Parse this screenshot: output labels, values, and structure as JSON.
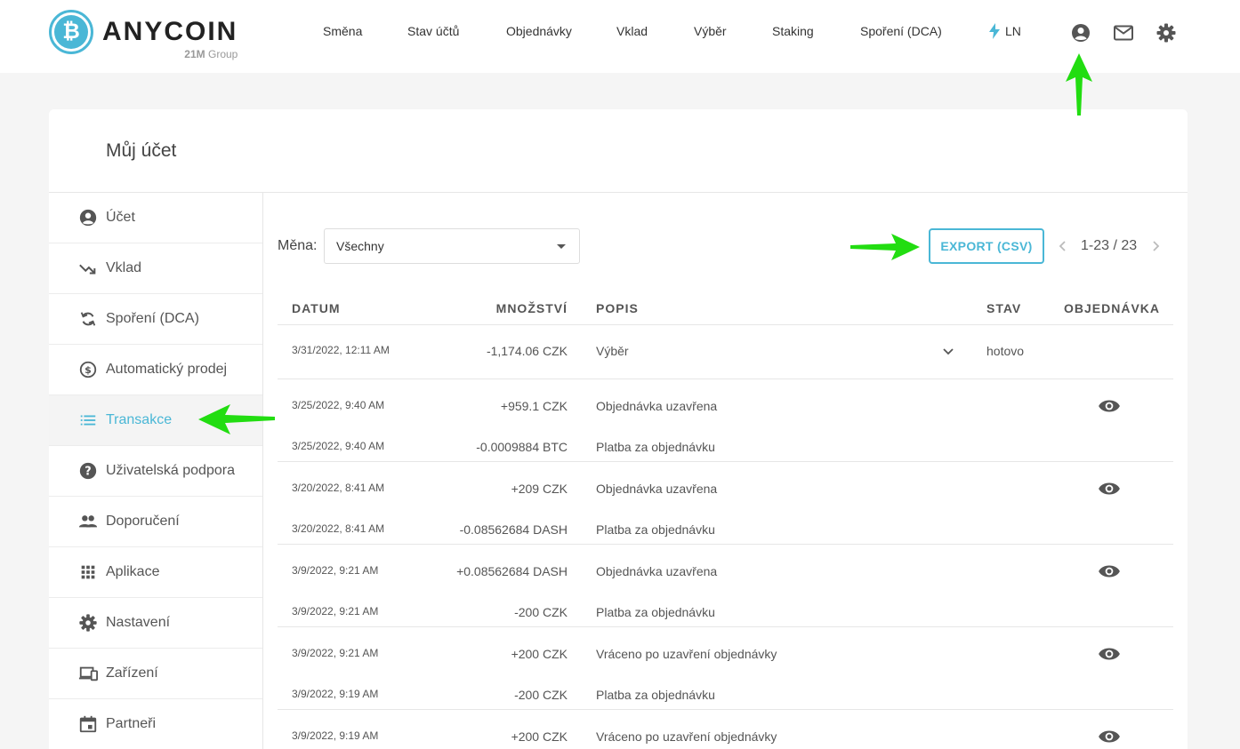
{
  "brand": {
    "name": "ANYCOIN",
    "sub_bold": "21M",
    "sub": "Group",
    "logo_glyph": "₿",
    "accent": "#4ab7d6"
  },
  "nav": {
    "items": [
      "Směna",
      "Stav účtů",
      "Objednávky",
      "Vklad",
      "Výběr",
      "Staking",
      "Spoření (DCA)"
    ],
    "ln_label": "LN"
  },
  "icons": {
    "account": "account-circle-icon",
    "mail": "mail-icon",
    "settings": "gear-icon"
  },
  "page": {
    "title": "Můj účet"
  },
  "sidebar": {
    "items": [
      {
        "label": "Účet",
        "icon": "account-circle-icon"
      },
      {
        "label": "Vklad",
        "icon": "trending-down-icon"
      },
      {
        "label": "Spoření (DCA)",
        "icon": "sync-icon"
      },
      {
        "label": "Automatický prodej",
        "icon": "currency-exchange-icon"
      },
      {
        "label": "Transakce",
        "icon": "list-icon"
      },
      {
        "label": "Uživatelská podpora",
        "icon": "help-icon"
      },
      {
        "label": "Doporučení",
        "icon": "people-icon"
      },
      {
        "label": "Aplikace",
        "icon": "apps-grid-icon"
      },
      {
        "label": "Nastavení",
        "icon": "gear-icon"
      },
      {
        "label": "Zařízení",
        "icon": "devices-icon"
      },
      {
        "label": "Partneři",
        "icon": "calendar-icon"
      }
    ],
    "active": "Transakce"
  },
  "filter": {
    "label": "Měna:",
    "value": "Všechny"
  },
  "export_label": "EXPORT (CSV)",
  "pager": {
    "text": "1-23 / 23"
  },
  "table": {
    "headers": {
      "date": "DATUM",
      "amount": "MNOŽSTVÍ",
      "desc": "POPIS",
      "status": "STAV",
      "order": "OBJEDNÁVKA"
    },
    "rows": [
      {
        "date": "3/31/2022, 12:11 AM",
        "amount": "-1,174.06 CZK",
        "desc": "Výběr",
        "status": "hotovo"
      },
      {
        "date": "3/25/2022, 9:40 AM",
        "amount": "+959.1 CZK",
        "desc": "Objednávka uzavřena",
        "status": ""
      },
      {
        "date": "3/25/2022, 9:40 AM",
        "amount": "-0.0009884 BTC",
        "desc": "Platba za objednávku",
        "status": ""
      },
      {
        "date": "3/20/2022, 8:41 AM",
        "amount": "+209 CZK",
        "desc": "Objednávka uzavřena",
        "status": ""
      },
      {
        "date": "3/20/2022, 8:41 AM",
        "amount": "-0.08562684 DASH",
        "desc": "Platba za objednávku",
        "status": ""
      },
      {
        "date": "3/9/2022, 9:21 AM",
        "amount": "+0.08562684 DASH",
        "desc": "Objednávka uzavřena",
        "status": ""
      },
      {
        "date": "3/9/2022, 9:21 AM",
        "amount": "-200 CZK",
        "desc": "Platba za objednávku",
        "status": ""
      },
      {
        "date": "3/9/2022, 9:21 AM",
        "amount": "+200 CZK",
        "desc": "Vráceno po uzavření objednávky",
        "status": ""
      },
      {
        "date": "3/9/2022, 9:19 AM",
        "amount": "-200 CZK",
        "desc": "Platba za objednávku",
        "status": ""
      },
      {
        "date": "3/9/2022, 9:19 AM",
        "amount": "+200 CZK",
        "desc": "Vráceno po uzavření objednávky",
        "status": ""
      }
    ]
  },
  "annotation_color": "#22dd11"
}
